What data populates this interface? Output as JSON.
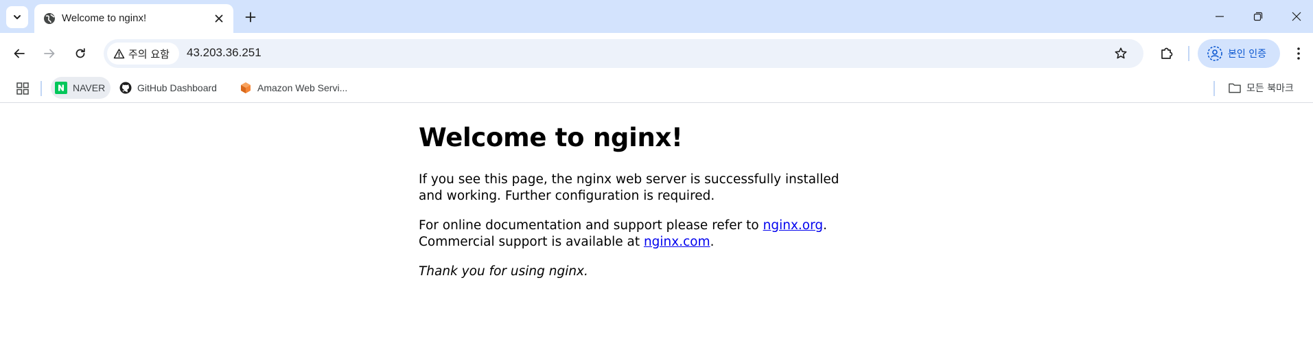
{
  "browser": {
    "tab": {
      "title": "Welcome to nginx!"
    },
    "address_bar": {
      "security_chip": "주의 요함",
      "url": "43.203.36.251"
    },
    "profile": {
      "label": "본인 인증"
    },
    "bookmarks": [
      {
        "label": "NAVER",
        "icon": "naver-icon",
        "icon_color": "#03c75a"
      },
      {
        "label": "GitHub Dashboard",
        "icon": "github-icon"
      },
      {
        "label": "Amazon Web Servi...",
        "icon": "aws-icon",
        "icon_color": "#f58536"
      }
    ],
    "all_bookmarks_label": "모든 북마크",
    "colors": {
      "tabstrip": "#d3e3fd",
      "omnibox": "#edf2fa",
      "accent": "#0b57d0"
    }
  },
  "page": {
    "heading": "Welcome to nginx!",
    "para1": "If you see this page, the nginx web server is successfully installed and working. Further configuration is required.",
    "para2_prefix": "For online documentation and support please refer to ",
    "link_org": "nginx.org",
    "para2_mid": ".",
    "para2_line2_prefix": "Commercial support is available at ",
    "link_com": "nginx.com",
    "para2_end": ".",
    "para3": "Thank you for using nginx.",
    "link_color": "#0000ee"
  }
}
